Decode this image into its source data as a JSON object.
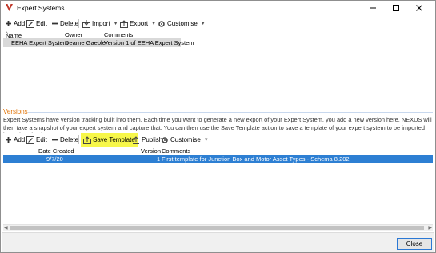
{
  "window": {
    "title": "Expert Systems"
  },
  "toolbar1": {
    "add": "Add",
    "edit": "Edit",
    "delete": "Delete",
    "import": "Import",
    "export": "Export",
    "customise": "Customise"
  },
  "grid1": {
    "columns": [
      "Name",
      "Owner",
      "Comments"
    ],
    "rows": [
      {
        "name": "EEHA Expert System",
        "owner": "Dearne Gaebler",
        "comments": "Version 1 of EEHA Expert System"
      }
    ]
  },
  "versions": {
    "label": "Versions",
    "description": "Expert Systems have version tracking built into them. Each time you want to generate a new export of your Expert System, you add a new version here, NEXUS will then take a snapshot of your expert system and capture that. You can then use the Save Template action to save a template of your expert system to be imported into other databases."
  },
  "toolbar2": {
    "add": "Add",
    "edit": "Edit",
    "delete": "Delete",
    "save_template": "Save Template",
    "publish": "Publish",
    "customise": "Customise"
  },
  "grid2": {
    "columns": [
      "Date Created",
      "Version",
      "Comments"
    ],
    "rows": [
      {
        "date_created": "9/7/20",
        "version": "1",
        "comments": "First template for Junction Box and Motor Asset Types - Schema 8.202"
      }
    ]
  },
  "footer": {
    "close": "Close"
  },
  "colors": {
    "selection": "#2d7fd3",
    "highlight": "#f7f74a",
    "section_label": "#e07000"
  }
}
